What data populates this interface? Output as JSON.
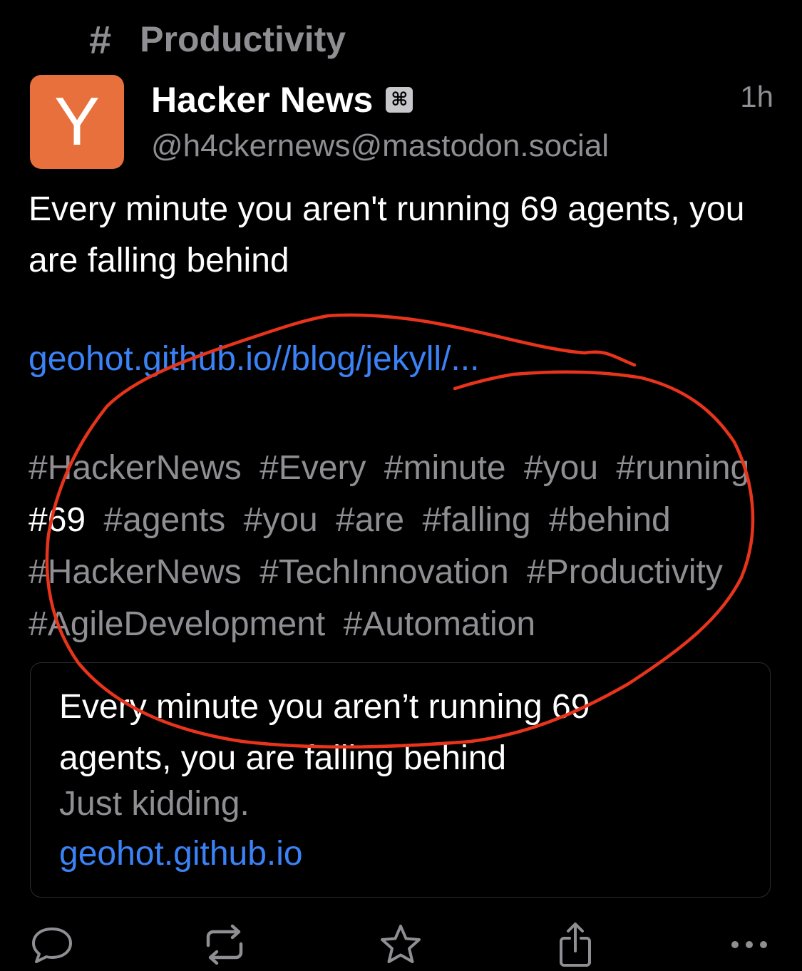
{
  "header": {
    "hash_symbol": "#",
    "tag": "Productivity"
  },
  "post": {
    "avatar_letter": "Y",
    "avatar_color": "#e8703c",
    "display_name": "Hacker News",
    "bot_badge": "⌘",
    "handle": "@h4ckernews@mastodon.social",
    "time": "1h",
    "body": "Every minute you aren't running 69 agents, you are falling behind",
    "link": "geohot.github.io//blog/jekyll/...",
    "hashtags": [
      {
        "text": "#HackerNews",
        "plain": false
      },
      {
        "text": "#Every",
        "plain": false
      },
      {
        "text": "#minute",
        "plain": false
      },
      {
        "text": "#you",
        "plain": false
      },
      {
        "text": "#running",
        "plain": false
      },
      {
        "text": "#69",
        "plain": true
      },
      {
        "text": "#agents",
        "plain": false
      },
      {
        "text": "#you",
        "plain": false
      },
      {
        "text": "#are",
        "plain": false
      },
      {
        "text": "#falling",
        "plain": false
      },
      {
        "text": "#behind",
        "plain": false
      },
      {
        "text": "#HackerNews",
        "plain": false
      },
      {
        "text": "#TechInnovation",
        "plain": false
      },
      {
        "text": "#Productivity",
        "plain": false
      },
      {
        "text": "#AgileDevelopment",
        "plain": false
      },
      {
        "text": "#Automation",
        "plain": false
      }
    ]
  },
  "card": {
    "title": "Every minute you aren’t running 69 agents, you are falling behind",
    "description": "Just kidding.",
    "url": "geohot.github.io"
  },
  "actions": [
    {
      "name": "reply",
      "icon": "speech-bubble-icon"
    },
    {
      "name": "boost",
      "icon": "repeat-icon"
    },
    {
      "name": "favourite",
      "icon": "star-icon"
    },
    {
      "name": "share",
      "icon": "share-icon"
    },
    {
      "name": "more",
      "icon": "ellipsis-icon"
    }
  ],
  "colors": {
    "background": "#000000",
    "secondary_text": "#8e8e93",
    "link": "#3b82f6",
    "annotation": "#e8341c"
  }
}
